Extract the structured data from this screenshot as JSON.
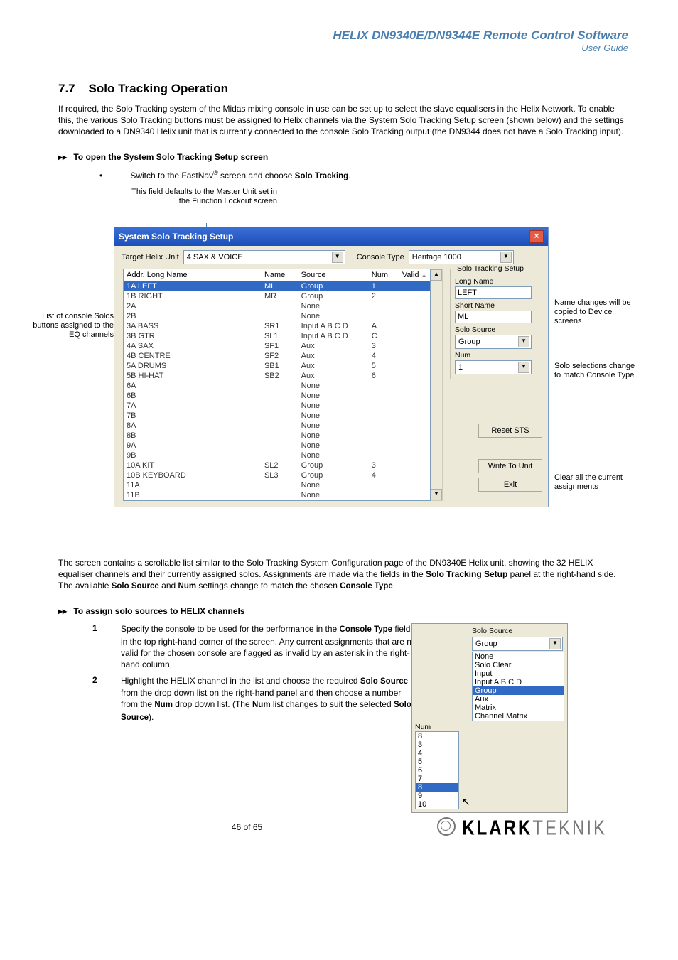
{
  "header": {
    "title": "HELIX DN9340E/DN9344E Remote Control Software",
    "subtitle": "User Guide"
  },
  "section": {
    "num": "7.7",
    "title": "Solo Tracking Operation",
    "intro": "If required, the Solo Tracking system of the Midas mixing console in use can be set up to select the slave equalisers in the Helix Network.  To enable this, the various Solo Tracking buttons must be assigned to Helix channels via the System Solo Tracking Setup screen (shown below) and the settings downloaded to a DN9340 Helix unit that is currently connected to the console Solo Tracking output (the DN9344 does not have a Solo Tracking input)."
  },
  "proc1": {
    "heading": "To open the System Solo Tracking Setup screen",
    "step_prefix": "Switch to the FastNav",
    "step_mid": " screen and choose ",
    "step_ui": "Solo Tracking",
    "step_suffix": "."
  },
  "callouts": {
    "topnote": "This field defaults to the Master Unit set in the Function Lockout screen",
    "left": "List of console Solos buttons assigned to the EQ channels",
    "right1": "Name changes will be copied to Device screens",
    "right2": "Solo selections change to match Console Type",
    "right3": "Clear all the current assignments"
  },
  "win": {
    "title": "System Solo Tracking Setup",
    "target_label": "Target Helix Unit",
    "target_value": "4     SAX & VOICE",
    "console_label": "Console Type",
    "console_value": "Heritage 1000",
    "cols": [
      "Addr. Long Name",
      "Name",
      "Source",
      "Num",
      "Valid"
    ],
    "rows": [
      {
        "a": "1A LEFT",
        "n": "ML",
        "s": "Group",
        "u": "1",
        "sel": true
      },
      {
        "a": "1B RIGHT",
        "n": "MR",
        "s": "Group",
        "u": "2"
      },
      {
        "a": "2A",
        "n": "",
        "s": "None",
        "u": ""
      },
      {
        "a": "2B",
        "n": "",
        "s": "None",
        "u": ""
      },
      {
        "a": "3A BASS",
        "n": "SR1",
        "s": "Input A B C D",
        "u": "A"
      },
      {
        "a": "3B GTR",
        "n": "SL1",
        "s": "Input A B C D",
        "u": "C"
      },
      {
        "a": "4A SAX",
        "n": "SF1",
        "s": "Aux",
        "u": "3"
      },
      {
        "a": "4B CENTRE",
        "n": "SF2",
        "s": "Aux",
        "u": "4"
      },
      {
        "a": "5A DRUMS",
        "n": "SB1",
        "s": "Aux",
        "u": "5"
      },
      {
        "a": "5B HI-HAT",
        "n": "SB2",
        "s": "Aux",
        "u": "6"
      },
      {
        "a": "6A",
        "n": "",
        "s": "None",
        "u": ""
      },
      {
        "a": "6B",
        "n": "",
        "s": "None",
        "u": ""
      },
      {
        "a": "7A",
        "n": "",
        "s": "None",
        "u": ""
      },
      {
        "a": "7B",
        "n": "",
        "s": "None",
        "u": ""
      },
      {
        "a": "8A",
        "n": "",
        "s": "None",
        "u": ""
      },
      {
        "a": "8B",
        "n": "",
        "s": "None",
        "u": ""
      },
      {
        "a": "9A",
        "n": "",
        "s": "None",
        "u": ""
      },
      {
        "a": "9B",
        "n": "",
        "s": "None",
        "u": ""
      },
      {
        "a": "10A KIT",
        "n": "SL2",
        "s": "Group",
        "u": "3"
      },
      {
        "a": "10B KEYBOARD",
        "n": "SL3",
        "s": "Group",
        "u": "4"
      },
      {
        "a": "11A",
        "n": "",
        "s": "None",
        "u": ""
      },
      {
        "a": "11B",
        "n": "",
        "s": "None",
        "u": ""
      }
    ],
    "panel": {
      "legend": "Solo Tracking Setup",
      "long_name_label": "Long Name",
      "long_name_value": "LEFT",
      "short_name_label": "Short Name",
      "short_name_value": "ML",
      "solo_source_label": "Solo Source",
      "solo_source_value": "Group",
      "num_label": "Num",
      "num_value": "1"
    },
    "buttons": {
      "reset": "Reset STS",
      "write": "Write To Unit",
      "exit": "Exit"
    }
  },
  "after_shot": "The screen contains a scrollable list similar to the Solo Tracking System Configuration page of the DN9340E Helix unit, showing the 32 HELIX equaliser channels and their currently assigned solos. Assignments are made via the fields in the ",
  "after_shot_bold": "Solo Tracking Setup",
  "after_shot2": " panel at the right-hand side.  The available ",
  "after_shot_ss": "Solo Source",
  "after_shot3": " and ",
  "after_shot_num": "Num",
  "after_shot4": " settings change to match the chosen ",
  "after_shot_ct": "Console Type",
  "after_shot5": ".",
  "proc2": {
    "heading": "To assign solo sources to HELIX channels",
    "s1a": "Specify the console to be used for the performance in the ",
    "s1b": "Console Type",
    "s1c": " field in the top right-hand corner of the screen.  Any current assignments that are not valid for the chosen console are flagged as invalid by an asterisk in the right-hand column.",
    "s2a": "Highlight the HELIX channel in the list and choose the required ",
    "s2b": "Solo Source",
    "s2c": " from the drop down list on the right-hand panel and then choose a number from the ",
    "s2d": "Num",
    "s2e": " drop down list.  (The ",
    "s2f": "Num",
    "s2g": " list changes to suit the selected ",
    "s2h": "Solo Source",
    "s2i": ")."
  },
  "inset": {
    "ss_label": "Solo Source",
    "ss_value": "Group",
    "num_label": "Num",
    "num_col": [
      "8",
      "3",
      "4",
      "5",
      "6",
      "7",
      "8",
      "9",
      "10"
    ],
    "num_sel_index": 6,
    "options": [
      "None",
      "Solo Clear",
      "Input",
      "Input A B C D",
      "Group",
      "Aux",
      "Matrix",
      "Channel Matrix"
    ],
    "opt_sel_index": 4
  },
  "footer": {
    "page": "46 of 65",
    "brand1": "KLARK",
    "brand2": "TEKNIK"
  }
}
